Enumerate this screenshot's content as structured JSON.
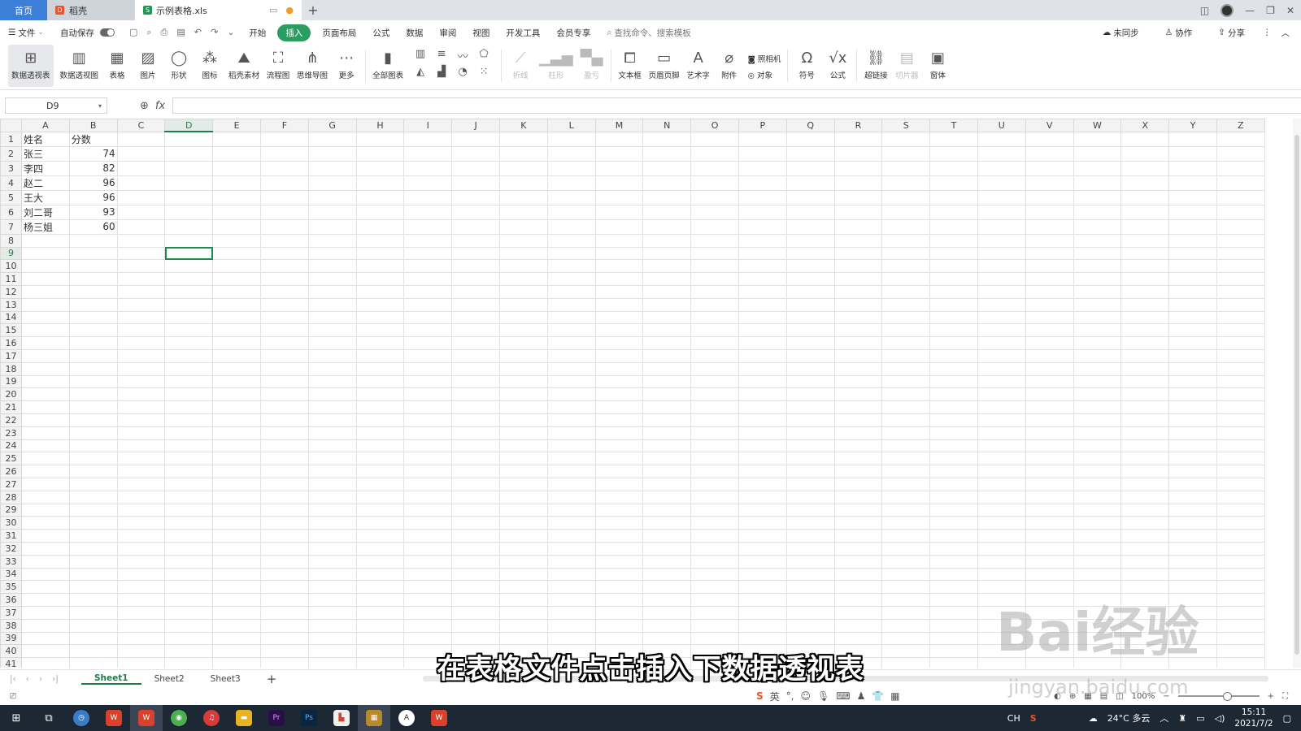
{
  "titlebar": {
    "tabs": [
      {
        "label": "首页"
      },
      {
        "label": "稻壳"
      },
      {
        "label": "示例表格.xls"
      }
    ]
  },
  "menubar": {
    "file": "文件",
    "autosave": "自动保存",
    "items": [
      "开始",
      "插入",
      "页面布局",
      "公式",
      "数据",
      "审阅",
      "视图",
      "开发工具",
      "会员专享"
    ],
    "search_placeholder": "查找命令、搜索模板",
    "right": {
      "sync": "未同步",
      "collab": "协作",
      "share": "分享"
    }
  },
  "ribbon": {
    "buttons": [
      {
        "label": "数据透视表",
        "icon": "pivot-table-icon"
      },
      {
        "label": "数据透视图",
        "icon": "pivot-chart-icon"
      },
      {
        "label": "表格",
        "icon": "table-icon"
      },
      {
        "label": "图片",
        "icon": "image-icon"
      },
      {
        "label": "形状",
        "icon": "shape-icon"
      },
      {
        "label": "图标",
        "icon": "icons-icon"
      },
      {
        "label": "稻壳素材",
        "icon": "material-icon"
      },
      {
        "label": "流程图",
        "icon": "flowchart-icon"
      },
      {
        "label": "思维导图",
        "icon": "mindmap-icon"
      },
      {
        "label": "更多",
        "icon": "more-icon"
      },
      {
        "label": "全部图表",
        "icon": "all-charts-icon"
      }
    ],
    "sparklines": [
      {
        "label": "折线"
      },
      {
        "label": "柱形"
      },
      {
        "label": "盈亏"
      }
    ],
    "buttons2": [
      {
        "label": "文本框",
        "icon": "textbox-icon"
      },
      {
        "label": "页眉页脚",
        "icon": "header-footer-icon"
      },
      {
        "label": "艺术字",
        "icon": "wordart-icon"
      },
      {
        "label": "附件",
        "icon": "attachment-icon"
      }
    ],
    "camera": "照相机",
    "object": "对象",
    "buttons3": [
      {
        "label": "符号",
        "icon": "symbol-icon"
      },
      {
        "label": "公式",
        "icon": "formula-icon"
      },
      {
        "label": "超链接",
        "icon": "hyperlink-icon"
      },
      {
        "label": "切片器",
        "icon": "slicer-icon"
      },
      {
        "label": "窗体",
        "icon": "form-icon"
      }
    ]
  },
  "formula_bar": {
    "cell_ref": "D9",
    "fx": "fx",
    "value": ""
  },
  "sheet": {
    "columns": [
      "A",
      "B",
      "C",
      "D",
      "E",
      "F",
      "G",
      "H",
      "I",
      "J",
      "K",
      "L",
      "M",
      "N",
      "O",
      "P",
      "Q",
      "R",
      "S",
      "T",
      "U",
      "V",
      "W",
      "X",
      "Y",
      "Z"
    ],
    "selected_cell": {
      "col": "D",
      "row": 9
    },
    "rows": [
      [
        "姓名",
        "分数"
      ],
      [
        "张三",
        "74"
      ],
      [
        "李四",
        "82"
      ],
      [
        "赵二",
        "96"
      ],
      [
        "王大",
        "96"
      ],
      [
        "刘二哥",
        "93"
      ],
      [
        "杨三姐",
        "60"
      ]
    ],
    "row_count": 42
  },
  "sheet_tabs": [
    "Sheet1",
    "Sheet2",
    "Sheet3"
  ],
  "statusbar": {
    "ime_lang": "英",
    "zoom": "100%"
  },
  "taskbar": {
    "weather": "24°C 多云",
    "ime": "CH",
    "time": "15:11",
    "date": "2021/7/2"
  },
  "caption": "在表格文件点击插入下数据透视表",
  "watermark": {
    "brand": "Bai经验",
    "url": "jingyan.baidu.com"
  }
}
